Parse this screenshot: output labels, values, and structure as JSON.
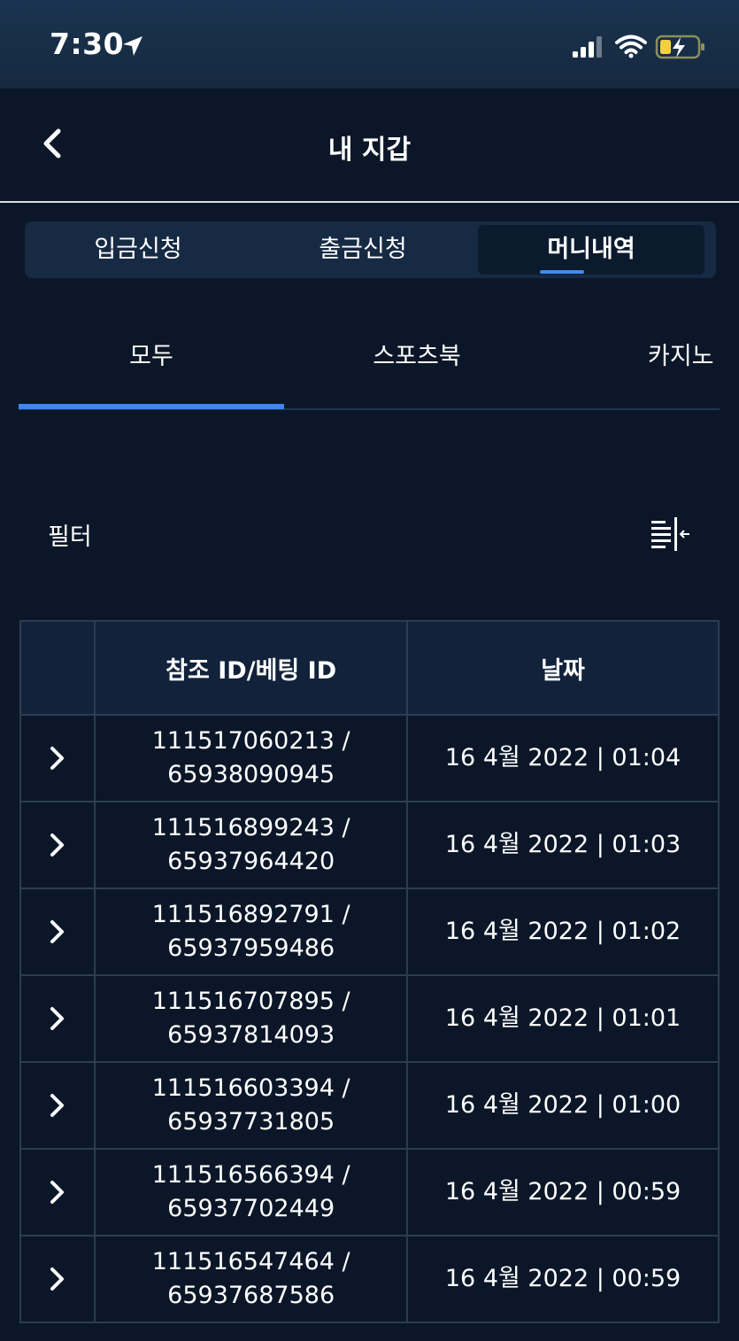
{
  "status_bar": {
    "time": "7:30"
  },
  "header": {
    "title": "내 지갑"
  },
  "segmented_tabs": [
    {
      "label": "입금신청",
      "active": false
    },
    {
      "label": "출금신청",
      "active": false
    },
    {
      "label": "머니내역",
      "active": true
    }
  ],
  "sub_tabs": [
    {
      "label": "모두",
      "active": true
    },
    {
      "label": "스포츠북",
      "active": false
    },
    {
      "label": "카지노",
      "active": false
    }
  ],
  "filter": {
    "label": "필터",
    "icon": "filter-collapse-icon"
  },
  "table": {
    "headers": [
      "",
      "참조 ID/베팅 ID",
      "날짜"
    ],
    "rows": [
      {
        "ref_id": "111517060213 /",
        "bet_id": "65938090945",
        "date": "16 4월 2022 | 01:04"
      },
      {
        "ref_id": "111516899243 /",
        "bet_id": "65937964420",
        "date": "16 4월 2022 | 01:03"
      },
      {
        "ref_id": "111516892791 /",
        "bet_id": "65937959486",
        "date": "16 4월 2022 | 01:02"
      },
      {
        "ref_id": "111516707895 /",
        "bet_id": "65937814093",
        "date": "16 4월 2022 | 01:01"
      },
      {
        "ref_id": "111516603394 /",
        "bet_id": "65937731805",
        "date": "16 4월 2022 | 01:00"
      },
      {
        "ref_id": "111516566394 /",
        "bet_id": "65937702449",
        "date": "16 4월 2022 | 00:59"
      },
      {
        "ref_id": "111516547464 /",
        "bet_id": "65937687586",
        "date": "16 4월 2022 | 00:59"
      }
    ]
  },
  "colors": {
    "background": "#0b1728",
    "accent": "#3e86f0",
    "table_header": "#11223a",
    "segmented_bg": "#162a44"
  }
}
